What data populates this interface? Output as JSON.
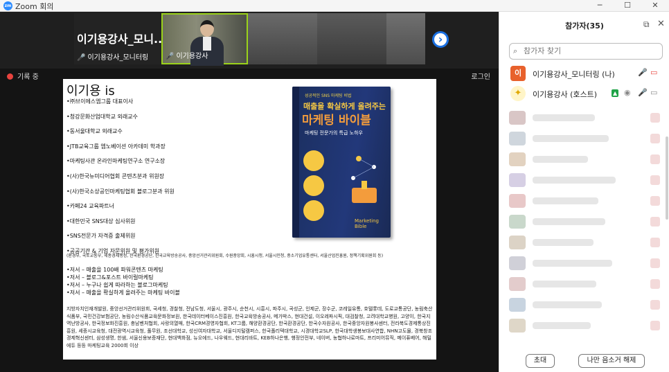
{
  "window": {
    "title": "Zoom 회의",
    "app_icon": "zm"
  },
  "video_strip": {
    "tiles": [
      {
        "name": "이기용강사_모니...",
        "label": "이기용강사_모니터링"
      },
      {
        "label": "이기용강사"
      }
    ],
    "recording_label": "기록 중",
    "login_label": "로그인"
  },
  "slide": {
    "heading": "이기용 is",
    "bullets": [
      "•㈜브이에스엠그룹 대표이사",
      "•청강문화산업대학교 외래교수",
      "•동서울대학교 외래교수",
      "•JTB교육그룹 엠노베이션 아카데미 학과장",
      "•마케팅사관 온라인마케팅연구소 연구소장",
      "•(사)한국뉴미디어협회 콘텐츠분과 위원장",
      "•(사)한국소상공인마케팅협회 블로그분과 위원",
      "•카페24 교육파트너",
      "•대한민국 SNS대상 심사위원",
      "•SNS전문가 자격증 출제위원",
      "•공공기관 & 기업 자문위원 및 평가위원"
    ],
    "gov_list": "(환경부, 국토교통부, 세종경제행정, 한국환경공단, 한국교육방송공사, 중앙선거관리위원회, 수원중앙회, 시흥시청, 서울시민청, 중소기업유통센터, 서울산업진흥원, 정책기획위원회 등)",
    "books": [
      "•저서 – 매출을 100배 파워콘텐츠 마케팅",
      "•저서 – 블로그&포스트 바이럴마케팅",
      "•저서 – 누구나 쉽게 따라하는 블로그마케팅",
      "•저서 – 매출을 확실하게 올려주는 마케팅 바이블"
    ],
    "career": "지방자치인재개발원, 중앙선거관리위원회, 국세청, 경찰청, 전남도청, 서울시, 광주시, 순천시, 시흥시, 파주시, 곡성군, 인제군, 장수군, 코레일유통, 호텔롯데, 도로교통공단, 농림축산식품부, 국민건강보험공단, 농림수산식품교육문화정보원, 한국데이터베이스진흥원, 한국교육방송공사, 메가박스, 현대건설, 이오레파시픽, 대검찰청, 고려대학교병원, 고양이, 한국지역난방공사, 한국정보화진흥원, 충남벤처협회, 사랑의열매, 한국CRM경영자협회, KT그룹, 해양환경공단, 한국환경공단, 한국수자원공사, 한국중앙자원봉사센터, 전라북도경제통상진흥원, 세종시교육청, 대전광역시교육청, 풀무원, 조선대학교, 성신여자대학교, 서울디지털캠퍼스, 한국폴리텍대학교, 시경대학교SLP, 한국대학생봉보대사연합, NHN고도몰, 경북창조경제혁신센터, 삼성생명, 한샘, 서울신용보증재단, 현대백화점, 뉴오에드, 나우웨드, 현대리바트, KEB하나은행, 행정안전부, 네이버, 농협하나로마트, 프리미어뮤직, 메이퓨베어, 해밀에듀 등등 마케팅교육 2000회 이상",
    "book_cover": {
      "series": "성공적인 SNS 마케팅 비법",
      "line1": "매출을 확실하게 올려주는",
      "line2": "마케팅 바이블",
      "line3": "마케팅 전문가의 특급 노하우",
      "badge": "Marketing Bible"
    }
  },
  "participants_panel": {
    "title": "참가자(35)",
    "search_placeholder": "참가자 찾기",
    "participants": [
      {
        "avatar": "이",
        "name": "이기용강사_모니터링 (나)"
      },
      {
        "avatar": "bulb",
        "name": "이기용강사 (호스트)"
      }
    ],
    "invite_button": "초대",
    "unmute_button": "나만 음소거 해제"
  },
  "colors": {
    "accent": "#2d8cff",
    "muted_red": "#e8433e",
    "active_border": "#9bd31a",
    "avatar_orange": "#e8612c"
  }
}
